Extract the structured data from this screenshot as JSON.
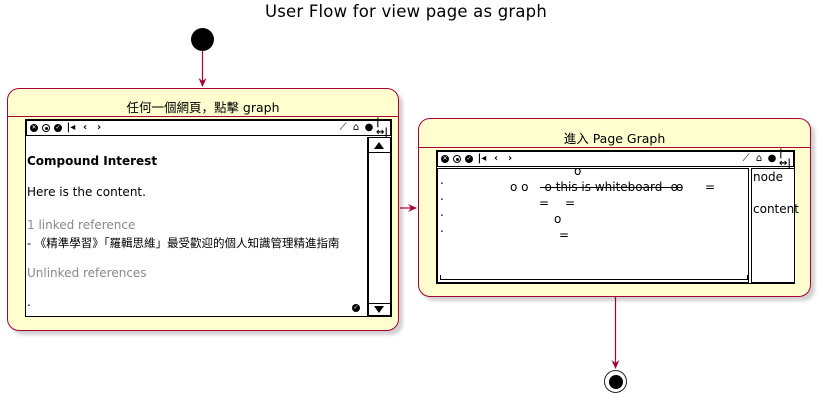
{
  "title": "User Flow for view page as graph",
  "states": [
    {
      "name": "任何一個網頁，點擊 graph",
      "page": {
        "heading": "Compound Interest",
        "body": "Here is the content.",
        "linked_header": "1 linked reference",
        "linked_item": "- 《精準學習》「羅輯思維」最受歡迎的個人知識管理精進指南",
        "unlinked_header": "Unlinked references",
        "footer_dot": "."
      }
    },
    {
      "name": "進入 Page Graph",
      "graph": {
        "rows": [
          ".",
          ".",
          ".",
          "."
        ],
        "node_top": "o",
        "row1_left": "o  o",
        "row1_strike": "-o this is whiteboard -o-",
        "row1_right": "o",
        "row1_eq": "=",
        "row2_a": "=",
        "row2_b": "=",
        "row3_node": "o",
        "row4_eq": "=",
        "panel_node": "node",
        "panel_content": "content"
      }
    }
  ],
  "colors": {
    "state_fill": "#fefece",
    "state_border": "#a80036",
    "arrow": "#a80036"
  }
}
